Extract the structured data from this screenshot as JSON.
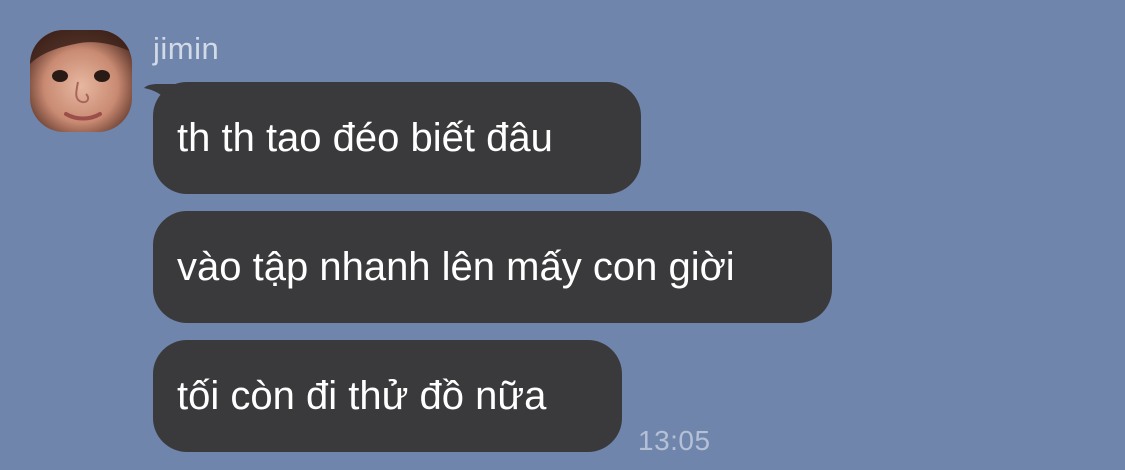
{
  "chat": {
    "sender_name": "jimin",
    "avatar": "profile-photo",
    "messages": [
      {
        "text": "th th tao đéo biết đâu"
      },
      {
        "text": "vào tập nhanh lên mấy con giời"
      },
      {
        "text": "tối còn đi thử đồ nữa"
      }
    ],
    "last_timestamp": "13:05"
  },
  "colors": {
    "background": "#7085AB",
    "bubble": "#3A3A3C",
    "message_text": "#FFFFFF",
    "meta_text": "#B4C0D6"
  }
}
